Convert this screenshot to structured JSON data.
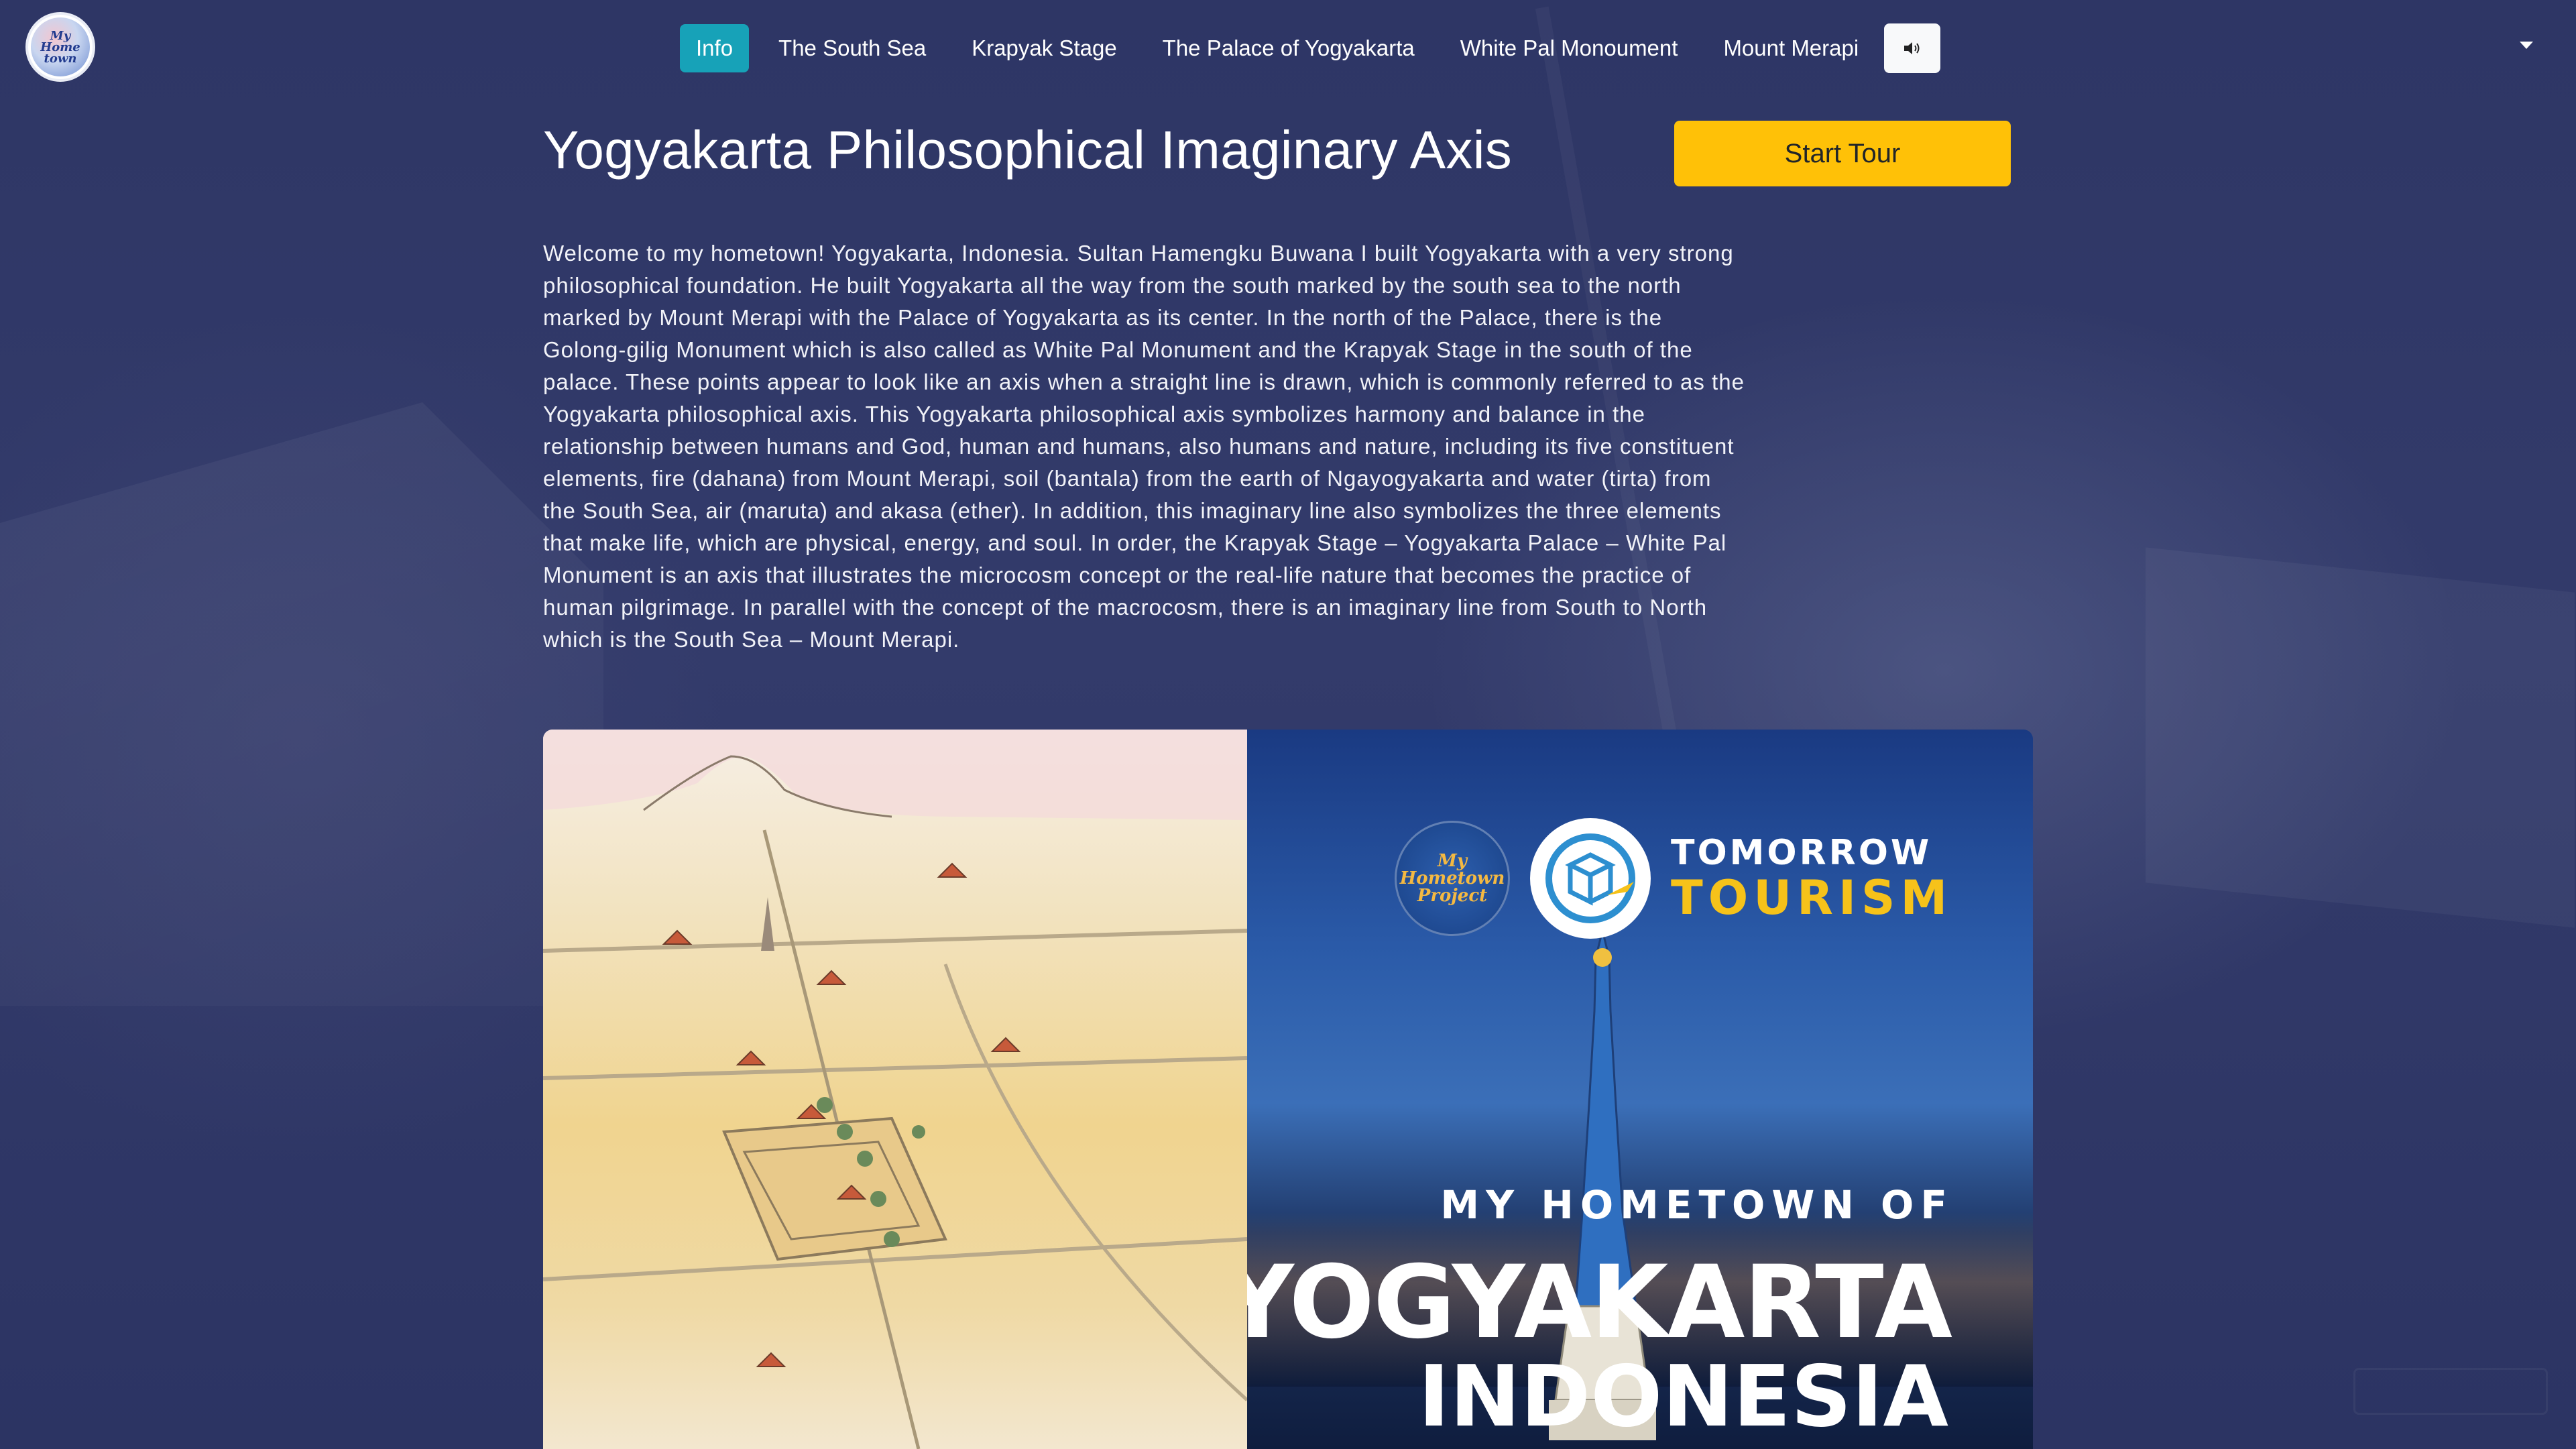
{
  "nav": {
    "items": [
      {
        "label": "Info",
        "active": true
      },
      {
        "label": "The South Sea",
        "active": false
      },
      {
        "label": "Krapyak Stage",
        "active": false
      },
      {
        "label": "The Palace of Yogyakarta",
        "active": false
      },
      {
        "label": "White Pal Monoument",
        "active": false
      },
      {
        "label": "Mount Merapi",
        "active": false
      }
    ],
    "sound_icon": "speaker-icon",
    "menu_icon": "caret-down-icon"
  },
  "header": {
    "title": "Yogyakarta Philosophical Imaginary Axis",
    "start_tour_label": "Start Tour"
  },
  "description": "Welcome to my hometown! Yogyakarta, Indonesia. Sultan Hamengku Buwana I built Yogyakarta with a very strong philosophical foundation. He built Yogyakarta all the way from the south marked by the south sea to the north marked by Mount Merapi with the Palace of Yogyakarta as its center. In the north of the Palace, there is the Golong-gilig Monument which is also called as White Pal Monument and the Krapyak Stage in the south of the palace. These points appear to look like an axis when a straight line is drawn, which is commonly referred to as the Yogyakarta philosophical axis. This Yogyakarta philosophical axis symbolizes harmony and balance in the relationship between humans and God, human and humans, also humans and nature, including its five constituent elements, fire (dahana) from Mount Merapi, soil (bantala) from the earth of Ngayogyakarta and water (tirta) from the South Sea, air (maruta) and akasa (ether). In addition, this imaginary line also symbolizes the three elements that make life, which are physical, energy, and soul. In order, the Krapyak Stage – Yogyakarta Palace – White Pal Monument is an axis that illustrates the microcosm concept or the real-life nature that becomes the practice of human pilgrimage. In parallel with the concept of the macrocosm, there is an imaginary line from South to North which is the South Sea – Mount Merapi.",
  "banner": {
    "brand_top": "TOMORROW",
    "brand_bottom": "TOURISM",
    "subtitle": "MY HOMETOWN OF",
    "city": "YOGYAKARTA",
    "country": "INDONESIA"
  },
  "colors": {
    "accent_active": "#17a2b8",
    "cta": "#ffc107",
    "background": "#2e3665"
  }
}
